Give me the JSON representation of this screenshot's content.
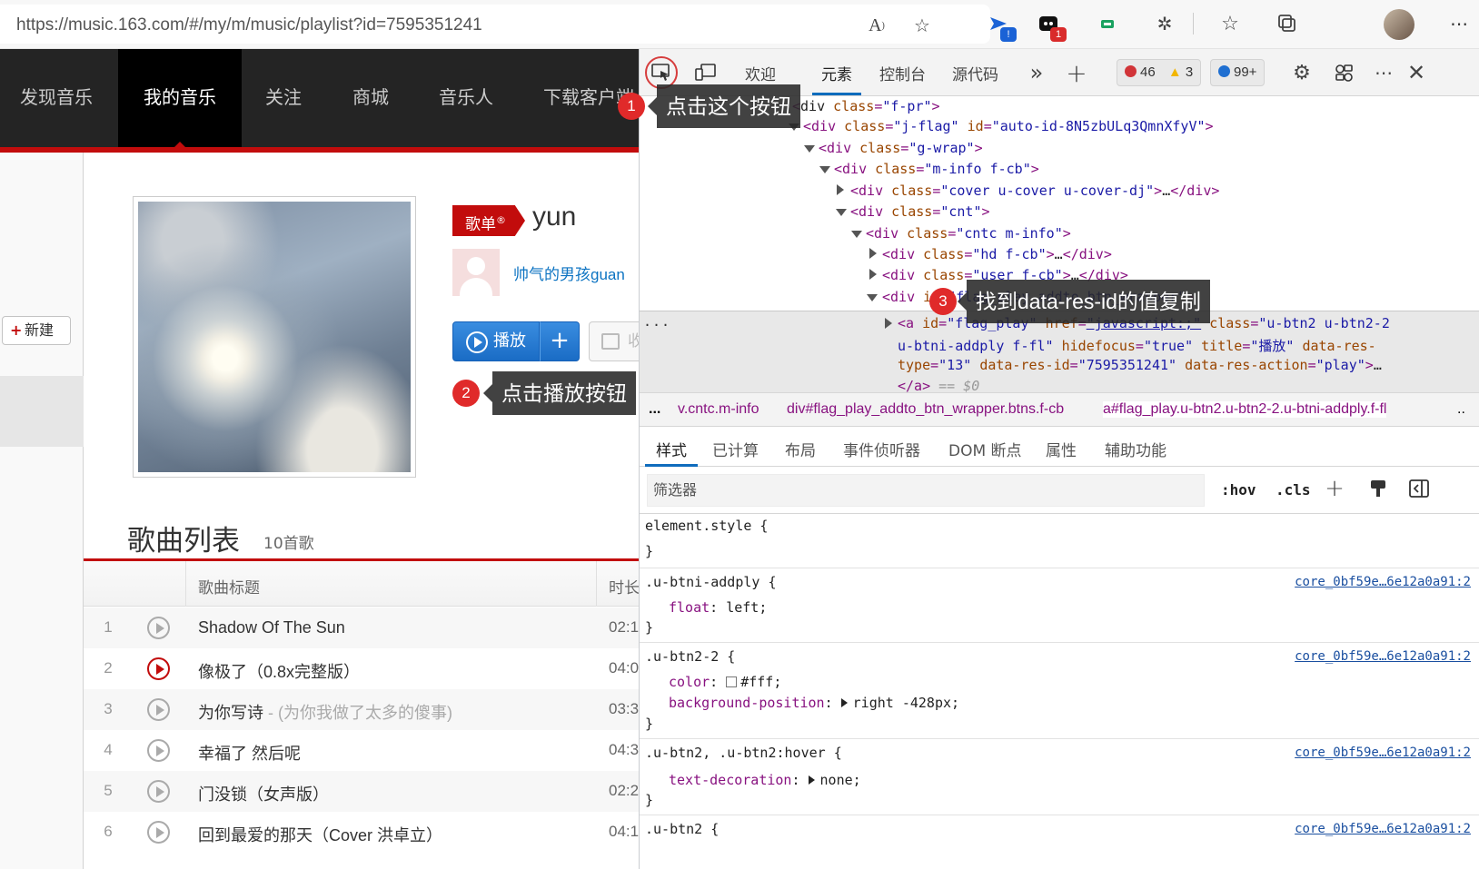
{
  "browser": {
    "url": "https://music.163.com/#/my/m/music/playlist?id=7595351241",
    "ext_badge_1": "!",
    "ext_badge_2": "1",
    "colors": {
      "badge_blue": "#1a62d6",
      "badge_red": "#d92b2b"
    }
  },
  "page": {
    "nav": [
      "发现音乐",
      "我的音乐",
      "关注",
      "商城",
      "音乐人",
      "下载客户端"
    ],
    "new_button": "新建",
    "tag": "歌单",
    "tag_mark": "®",
    "playlist_title": "yun",
    "creator": "帅气的男孩guan",
    "play_label": "播放",
    "add_label": "+",
    "fav_label": "收藏",
    "list_title": "歌曲列表",
    "list_count": "10首歌",
    "th_title": "歌曲标题",
    "th_duration": "时长",
    "songs": [
      {
        "num": "1",
        "title": "Shadow Of The Sun",
        "sub": "",
        "dur": "02:1"
      },
      {
        "num": "2",
        "title": "像极了（0.8x完整版）",
        "sub": "",
        "dur": "04:0"
      },
      {
        "num": "3",
        "title": "为你写诗",
        "sub": " - (为你我做了太多的傻事)",
        "dur": "03:3"
      },
      {
        "num": "4",
        "title": "幸福了 然后呢",
        "sub": "",
        "dur": "04:3"
      },
      {
        "num": "5",
        "title": "门没锁（女声版）",
        "sub": "",
        "dur": "02:2"
      },
      {
        "num": "6",
        "title": "回到最爱的那天（Cover 洪卓立）",
        "sub": "",
        "dur": "04:1"
      }
    ]
  },
  "devtools": {
    "tabs": [
      "欢迎",
      "元素",
      "控制台",
      "源代码"
    ],
    "more": "»",
    "plus": "+",
    "errors": "46",
    "warnings": "3",
    "messages": "99+",
    "dom_lines": [
      {
        "indent": 0,
        "arrow": "",
        "html": "<div class=\"f-pr\">"
      },
      {
        "indent": 1,
        "arrow": "down",
        "html": "<div class=\"j-flag\" id=\"auto-id-8N5zbULq3QmnXfyV\">"
      },
      {
        "indent": 2,
        "arrow": "down",
        "html": "<div class=\"g-wrap\">"
      },
      {
        "indent": 3,
        "arrow": "down",
        "html": "<div class=\"m-info f-cb\">"
      },
      {
        "indent": 4,
        "arrow": "right",
        "html": "<div class=\"cover u-cover u-cover-dj\">…</div>"
      },
      {
        "indent": 4,
        "arrow": "down",
        "html": "<div class=\"cnt\">"
      },
      {
        "indent": 5,
        "arrow": "down",
        "html": "<div class=\"cntc m-info\">"
      },
      {
        "indent": 6,
        "arrow": "right",
        "html": "<div class=\"hd f-cb\">…</div>"
      },
      {
        "indent": 6,
        "arrow": "right",
        "html": "<div class=\"user f-cb\">…</div>"
      },
      {
        "indent": 6,
        "arrow": "down",
        "html": "<div id=\"flag_play_addto_btn_wrapper\">"
      }
    ],
    "selected_lines": [
      "<a id=\"flag_play\" href=\"javascript:;\" class=\"u-btn2 u-btn2-2",
      "u-btni-addply f-fl\" hidefocus=\"true\" title=\"播放\" data-res-",
      "type=\"13\" data-res-id=\"7595351241\" data-res-action=\"play\">…",
      "</a> == $0"
    ],
    "ellipsis": "...",
    "crumbs": [
      "...",
      "v.cntc.m-info",
      "div#flag_play_addto_btn_wrapper.btns.f-cb",
      "a#flag_play.u-btn2.u-btn2-2.u-btni-addply.f-fl",
      ".."
    ],
    "sub_tabs": [
      "样式",
      "已计算",
      "布局",
      "事件侦听器",
      "DOM 断点",
      "属性",
      "辅助功能"
    ],
    "filter_placeholder": "筛选器",
    "hov": ":hov",
    "cls": ".cls",
    "source_link": "core_0bf59e…6e12a0a91:2",
    "rules": [
      {
        "selector": "element.style {",
        "props": []
      },
      {
        "selector": ".u-btni-addply {",
        "props": [
          {
            "name": "float",
            "value": "left;"
          }
        ]
      },
      {
        "selector": ".u-btn2-2 {",
        "props": [
          {
            "name": "color",
            "value": "#fff;",
            "swatch": true
          },
          {
            "name": "background-position",
            "value": "right -428px;",
            "tri": true
          }
        ]
      },
      {
        "selector": ".u-btn2, .u-btn2:hover {",
        "props": [
          {
            "name": "text-decoration",
            "value": "none;",
            "tri": true
          }
        ]
      },
      {
        "selector": ".u-btn2 {",
        "props": []
      }
    ]
  },
  "callouts": [
    {
      "num": "1",
      "text": "点击这个按钮"
    },
    {
      "num": "2",
      "text": "点击播放按钮"
    },
    {
      "num": "3",
      "text": "找到data-res-id的值复制"
    }
  ]
}
